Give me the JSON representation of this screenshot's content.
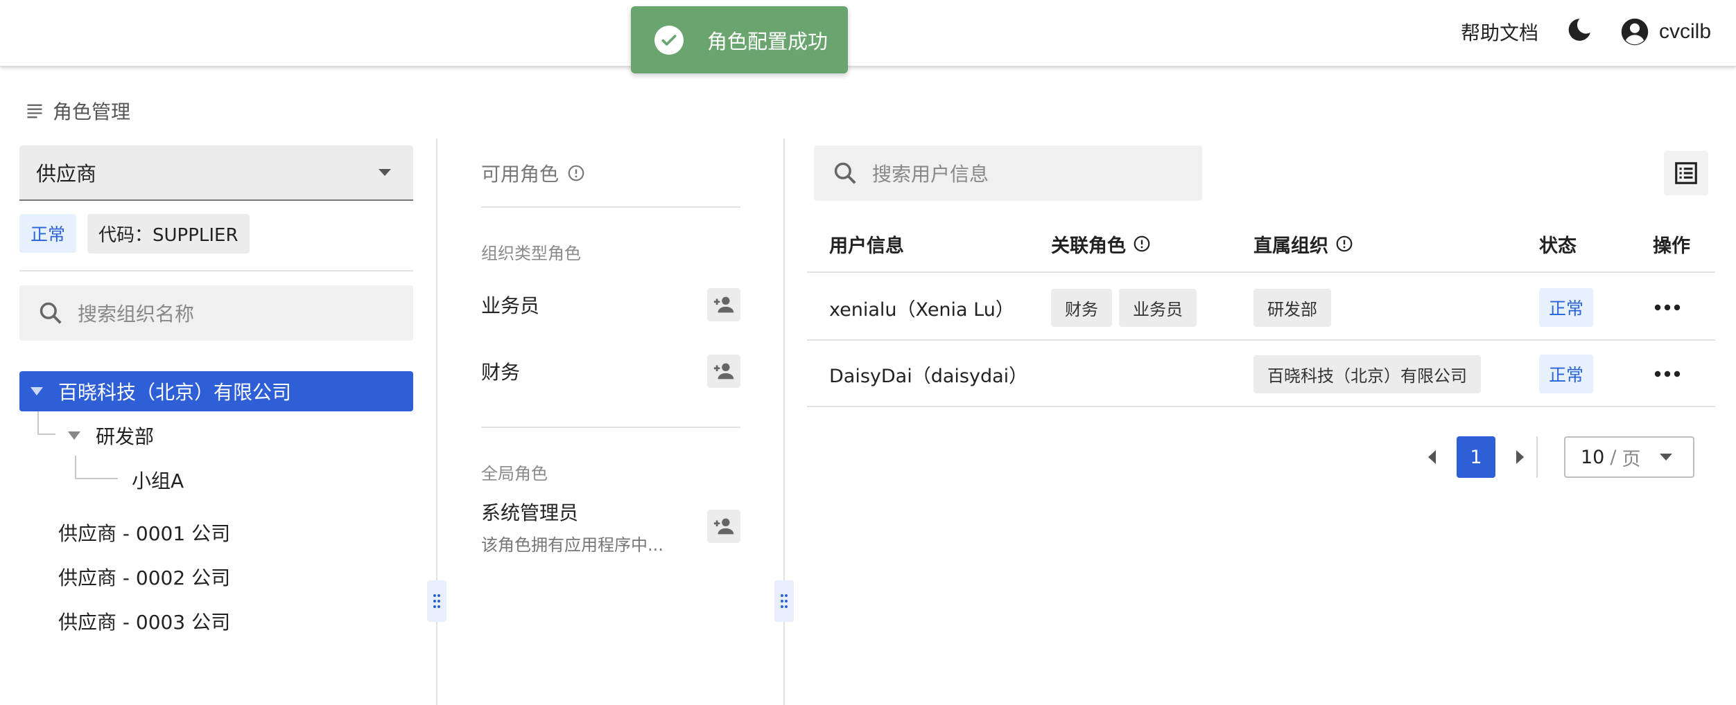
{
  "header": {
    "help_docs": "帮助文档",
    "username": "cvcilb",
    "icons": [
      "dark-mode-moon-icon",
      "account-circle-icon"
    ]
  },
  "toast": {
    "message": "角色配置成功",
    "color": "#6aa56f"
  },
  "breadcrumb": {
    "title": "角色管理"
  },
  "left": {
    "org_type_select": "供应商",
    "status_tag": "正常",
    "code_tag": "代码：SUPPLIER",
    "search_placeholder": "搜索组织名称",
    "tree": [
      {
        "label": "百晓科技（北京）有限公司",
        "selected": true,
        "expanded": true
      },
      {
        "label": "研发部",
        "expanded": true
      },
      {
        "label": "小组A"
      },
      {
        "label": "供应商 - 0001 公司"
      },
      {
        "label": "供应商 - 0002 公司"
      },
      {
        "label": "供应商 - 0003 公司"
      }
    ]
  },
  "middle": {
    "title": "可用角色",
    "org_section": "组织类型角色",
    "org_roles": [
      {
        "name": "业务员"
      },
      {
        "name": "财务"
      }
    ],
    "global_section": "全局角色",
    "global_roles": [
      {
        "name": "系统管理员",
        "desc": "该角色拥有应用程序中..."
      }
    ]
  },
  "right": {
    "search_placeholder": "搜索用户信息",
    "columns": [
      "用户信息",
      "关联角色",
      "直属组织",
      "状态",
      "操作"
    ],
    "rows": [
      {
        "user": "xenialu（Xenia Lu）",
        "roles": [
          "财务",
          "业务员"
        ],
        "org": "研发部",
        "status": "正常"
      },
      {
        "user": "DaisyDai（daisydai）",
        "roles": [],
        "org": "百晓科技（北京）有限公司",
        "status": "正常"
      }
    ],
    "pagination": {
      "current_page": "1",
      "page_size": "10",
      "page_size_unit": "页",
      "separator": "/"
    }
  },
  "colors": {
    "primary": "#2f5fd6",
    "success_toast": "#6aa56f",
    "status_bg": "#e7f0fd"
  }
}
